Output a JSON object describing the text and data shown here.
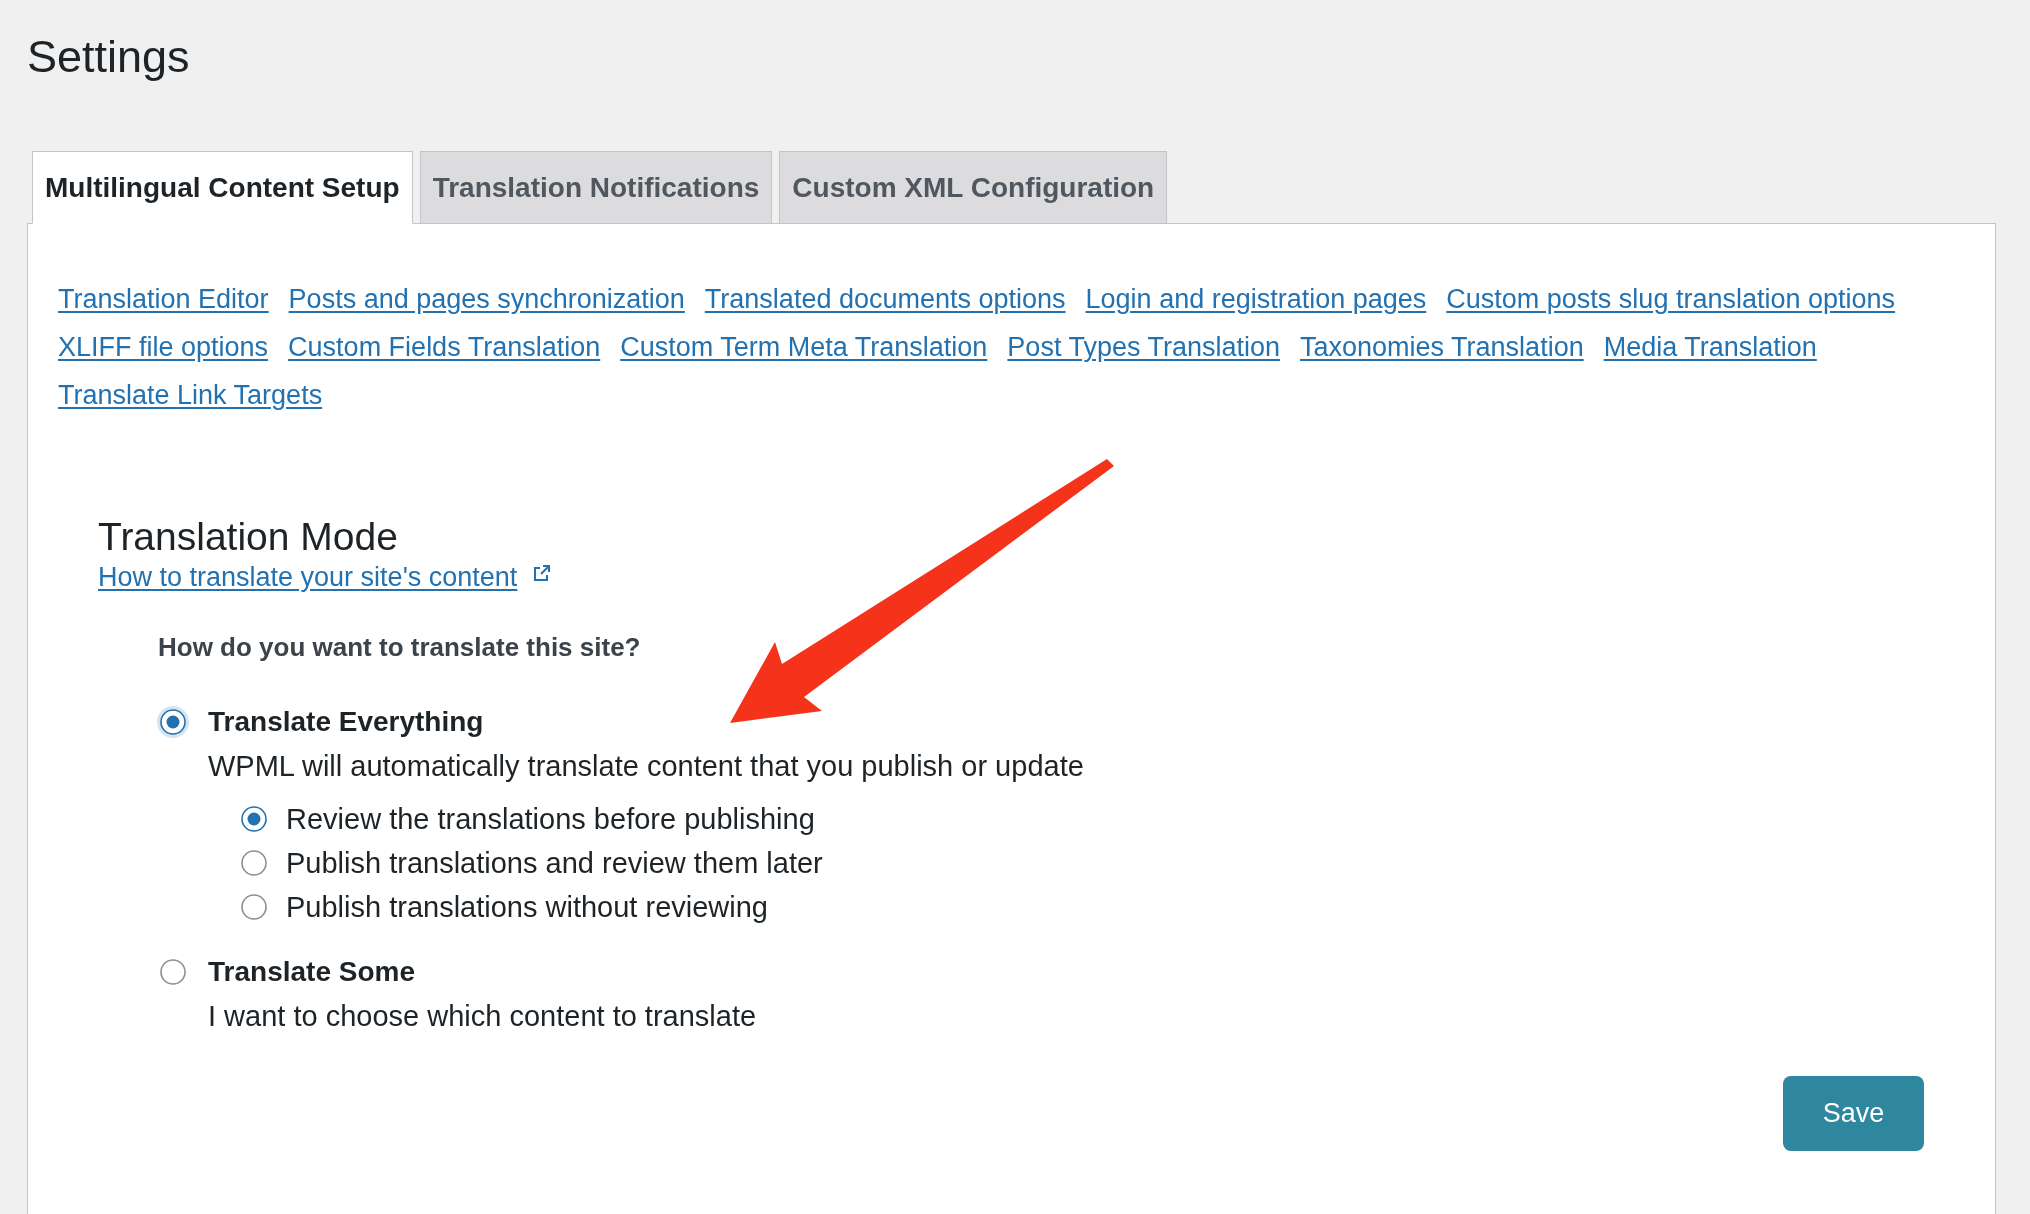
{
  "page": {
    "title": "Settings"
  },
  "tabs": [
    {
      "label": "Multilingual Content Setup",
      "selected": true
    },
    {
      "label": "Translation Notifications",
      "selected": false
    },
    {
      "label": "Custom XML Configuration",
      "selected": false
    }
  ],
  "quick_links": [
    "Translation Editor",
    "Posts and pages synchronization",
    "Translated documents options",
    "Login and registration pages",
    "Custom posts slug translation options",
    "XLIFF file options",
    "Custom Fields Translation",
    "Custom Term Meta Translation",
    "Post Types Translation",
    "Taxonomies Translation",
    "Media Translation",
    "Translate Link Targets"
  ],
  "translation_mode": {
    "heading": "Translation Mode",
    "help_link": "How to translate your site's content",
    "question": "How do you want to translate this site?",
    "options": [
      {
        "label": "Translate Everything",
        "description": "WPML will automatically translate content that you publish or update",
        "selected": true,
        "focused": true,
        "sub_options": [
          {
            "label": "Review the translations before publishing",
            "selected": true
          },
          {
            "label": "Publish translations and review them later",
            "selected": false
          },
          {
            "label": "Publish translations without reviewing",
            "selected": false
          }
        ]
      },
      {
        "label": "Translate Some",
        "description": "I want to choose which content to translate",
        "selected": false,
        "focused": false
      }
    ]
  },
  "save_button": {
    "label": "Save"
  }
}
